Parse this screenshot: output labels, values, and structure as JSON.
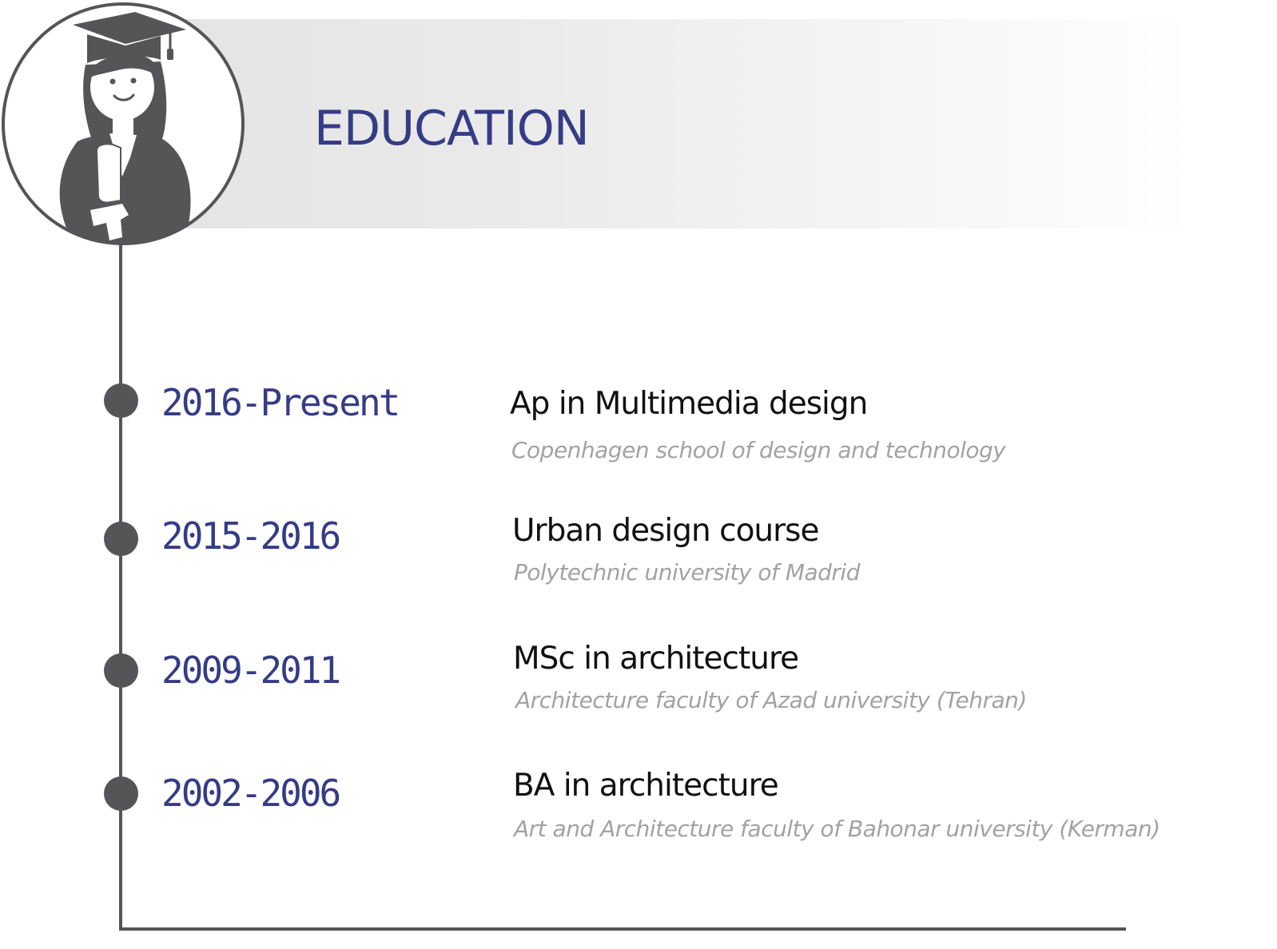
{
  "section": {
    "title": "EDUCATION",
    "avatar_icon": "graduate-woman-icon"
  },
  "colors": {
    "accent": "#353c86",
    "timeline": "#555558",
    "muted_text": "#a2a2a2"
  },
  "entries": [
    {
      "years": "2016-Present",
      "degree": "Ap in Multimedia design",
      "school": "Copenhagen school of design and technology"
    },
    {
      "years": "2015-2016",
      "degree": "Urban design course",
      "school": "Polytechnic university of Madrid"
    },
    {
      "years": "2009-2011",
      "degree": "MSc in architecture",
      "school": "Architecture faculty of Azad university (Tehran)"
    },
    {
      "years": "2002-2006",
      "degree": "BA in architecture",
      "school": "Art and Architecture faculty of Bahonar university (Kerman)"
    }
  ]
}
